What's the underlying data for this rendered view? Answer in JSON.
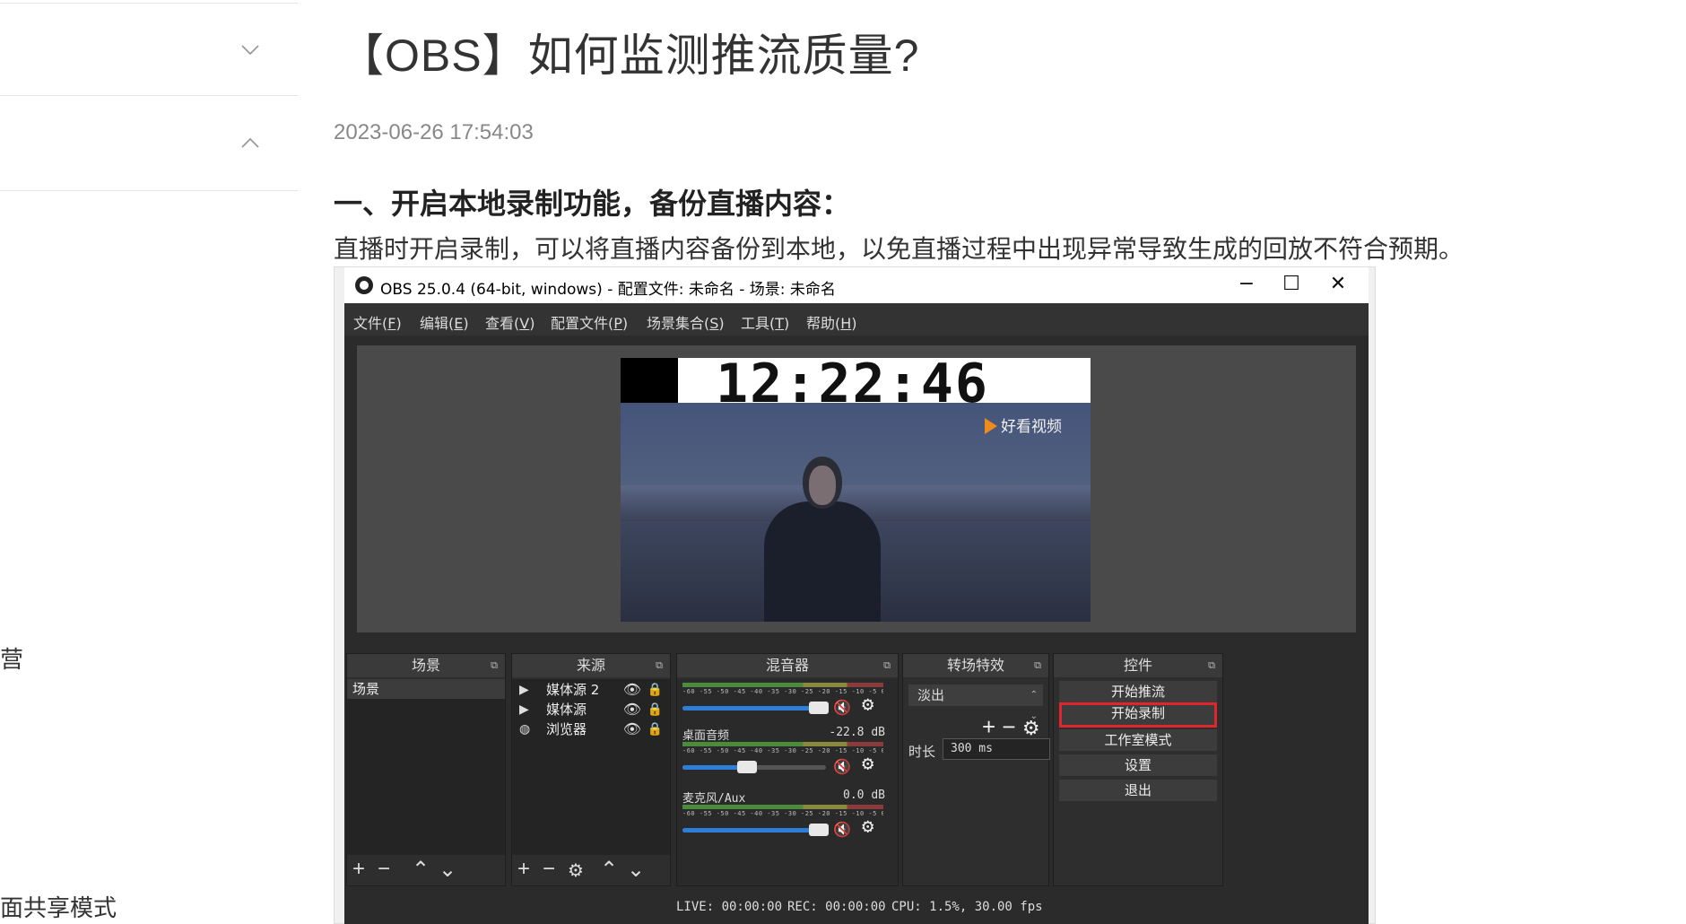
{
  "sidebar": {
    "partial_item_1": "营",
    "partial_item_2": "面共享模式"
  },
  "article": {
    "title": "【OBS】如何监测推流质量?",
    "date": "2023-06-26 17:54:03",
    "section_heading": "一、开启本地录制功能，备份直播内容：",
    "paragraph": "直播时开启录制，可以将直播内容备份到本地，以免直播过程中出现异常导致生成的回放不符合预期。"
  },
  "obs": {
    "window_title": "OBS 25.0.4 (64-bit, windows) - 配置文件: 未命名 - 场景: 未命名",
    "window_controls": [
      "−",
      "☐",
      "✕"
    ],
    "menu": [
      {
        "label": "文件(",
        "key": "F",
        "end": ")"
      },
      {
        "label": "编辑(",
        "key": "E",
        "end": ")"
      },
      {
        "label": "查看(",
        "key": "V",
        "end": ")"
      },
      {
        "label": "配置文件(",
        "key": "P",
        "end": ")"
      },
      {
        "label": "场景集合(",
        "key": "S",
        "end": ")"
      },
      {
        "label": "工具(",
        "key": "T",
        "end": ")"
      },
      {
        "label": "帮助(",
        "key": "H",
        "end": ")"
      }
    ],
    "preview": {
      "clock": "12:22:46",
      "watermark": "好看视频"
    },
    "docks": {
      "scenes": {
        "title": "场景",
        "items": [
          "场景"
        ]
      },
      "sources": {
        "title": "来源",
        "items": [
          {
            "name": "媒体源 2",
            "icon": "▶"
          },
          {
            "name": "媒体源",
            "icon": "▶"
          },
          {
            "name": "浏览器",
            "icon": "◍"
          }
        ]
      },
      "mixer": {
        "title": "混音器",
        "scale": "-60 -55 -50 -45 -40 -35 -30 -25 -20 -15 -10 -5 0",
        "channels": [
          {
            "name": "",
            "db": "",
            "level": 0.95
          },
          {
            "name": "桌面音频",
            "db": "-22.8 dB",
            "level": 0.45
          },
          {
            "name": "麦克风/Aux",
            "db": "0.0 dB",
            "level": 0.95
          }
        ]
      },
      "transitions": {
        "title": "转场特效",
        "selected": "淡出",
        "duration_label": "时长",
        "duration_value": "300 ms"
      },
      "controls": {
        "title": "控件",
        "buttons": [
          "开始推流",
          "开始录制",
          "工作室模式",
          "设置",
          "退出"
        ]
      }
    },
    "status": {
      "live": "LIVE: 00:00:00",
      "rec": "REC: 00:00:00",
      "cpu": "CPU: 1.5%, 30.00 fps"
    }
  },
  "colors": {
    "highlight": "#e0262c",
    "obs_background": "#2b2b2b",
    "volume_fill": "#2d7ed8",
    "muted_icon": "#e23030"
  }
}
